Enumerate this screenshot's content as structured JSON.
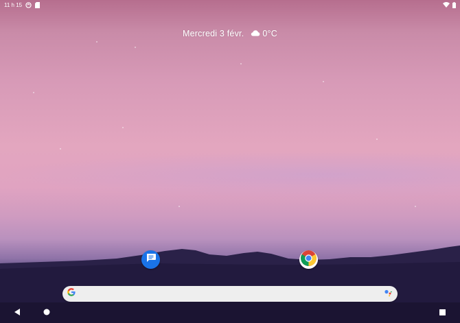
{
  "status_bar": {
    "time": "11 h 15",
    "icons": [
      "sync-icon",
      "sd-card-icon",
      "wifi-icon",
      "battery-icon"
    ]
  },
  "glance": {
    "date": "Mercredi 3 févr.",
    "temperature": "0°C",
    "weather_icon": "cloud-icon"
  },
  "home_apps": [
    {
      "name": "Messages",
      "icon": "messages-icon",
      "color": "#1a73e8"
    },
    {
      "name": "Chrome",
      "icon": "chrome-icon"
    }
  ],
  "search_bar": {
    "logo": "google-g-logo",
    "assistant_icon": "google-assistant-icon"
  },
  "nav_bar": {
    "buttons": [
      "back-button",
      "home-button",
      "recents-button"
    ]
  }
}
